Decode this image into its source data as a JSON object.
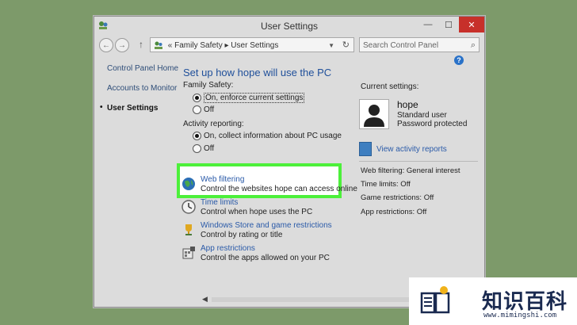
{
  "window": {
    "title": "User Settings",
    "controls": {
      "minimize": "—",
      "maximize": "☐",
      "close": "✕"
    }
  },
  "address": {
    "back": "←",
    "forward": "→",
    "up": "↑",
    "prefix": "«",
    "crumb1": "Family Safety",
    "sep": "▸",
    "crumb2": "User Settings",
    "dropdown": "▼",
    "refresh": "↻"
  },
  "search": {
    "placeholder": "Search Control Panel",
    "icon": "⌕"
  },
  "help": {
    "label": "?"
  },
  "sidebar": {
    "items": [
      {
        "label": "Control Panel Home"
      },
      {
        "label": "Accounts to Monitor"
      },
      {
        "label": "User Settings"
      }
    ]
  },
  "main": {
    "heading": "Set up how hope will use the PC",
    "family_safety_label": "Family Safety:",
    "fs_on": "On, enforce current settings",
    "fs_off": "Off",
    "activity_label": "Activity reporting:",
    "ar_on": "On, collect information about PC usage",
    "ar_off": "Off",
    "items": [
      {
        "title": "Web filtering",
        "desc": "Control the websites hope can access online"
      },
      {
        "title": "Time limits",
        "desc": "Control when hope uses the PC"
      },
      {
        "title": "Windows Store and game restrictions",
        "desc": "Control by rating or title"
      },
      {
        "title": "App restrictions",
        "desc": "Control the apps allowed on your PC"
      }
    ]
  },
  "current": {
    "heading": "Current settings:",
    "name": "hope",
    "role": "Standard user",
    "password": "Password protected",
    "view_reports": "View activity reports",
    "stats": [
      "Web filtering: General interest",
      "Time limits: Off",
      "Game restrictions: Off",
      "App restrictions: Off"
    ]
  },
  "scroll": {
    "left_arrow": "◀"
  },
  "watermark": {
    "brand": "知识百科",
    "url": "www.mimingshi.com"
  },
  "colors": {
    "highlight": "#4cf03a",
    "link": "#2a5aa8",
    "close": "#c7302a"
  }
}
